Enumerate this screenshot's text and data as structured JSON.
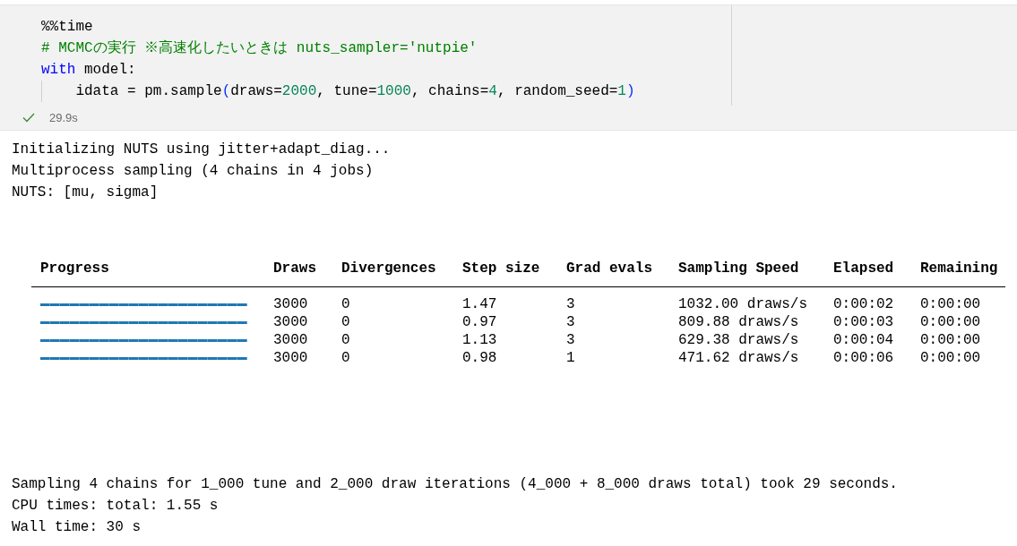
{
  "cell": {
    "code_lines": [
      {
        "indent_guide": false,
        "tokens": [
          {
            "kind": "plain",
            "text": "%%time"
          }
        ]
      },
      {
        "indent_guide": false,
        "tokens": [
          {
            "kind": "comment",
            "text": "# MCMCの実行 ※高速化したいときは nuts_sampler='nutpie'"
          }
        ]
      },
      {
        "indent_guide": false,
        "tokens": [
          {
            "kind": "keyword",
            "text": "with"
          },
          {
            "kind": "plain",
            "text": " model:"
          }
        ]
      },
      {
        "indent_guide": true,
        "tokens": [
          {
            "kind": "plain",
            "text": "    idata = pm.sample"
          },
          {
            "kind": "bracket",
            "text": "("
          },
          {
            "kind": "plain",
            "text": "draws="
          },
          {
            "kind": "number",
            "text": "2000"
          },
          {
            "kind": "plain",
            "text": ", tune="
          },
          {
            "kind": "number",
            "text": "1000"
          },
          {
            "kind": "plain",
            "text": ", chains="
          },
          {
            "kind": "number",
            "text": "4"
          },
          {
            "kind": "plain",
            "text": ", random_seed="
          },
          {
            "kind": "number",
            "text": "1"
          },
          {
            "kind": "bracket",
            "text": ")"
          }
        ]
      }
    ],
    "status": {
      "kind": "success",
      "duration": "29.9s"
    }
  },
  "output": {
    "log_lines": [
      "Initializing NUTS using jitter+adapt_diag...",
      "Multiprocess sampling (4 chains in 4 jobs)",
      "NUTS: [mu, sigma]"
    ],
    "progress_table": {
      "columns": [
        "Progress",
        "Draws",
        "Divergences",
        "Step size",
        "Grad evals",
        "Sampling Speed",
        "Elapsed",
        "Remaining"
      ],
      "rows": [
        {
          "cells": [
            {
              "kind": "progress",
              "level": 1
            },
            {
              "kind": "text",
              "text": "3000"
            },
            {
              "kind": "text",
              "text": "0"
            },
            {
              "kind": "text",
              "text": "1.47"
            },
            {
              "kind": "text",
              "text": "3"
            },
            {
              "kind": "text",
              "text": "1032.00 draws/s"
            },
            {
              "kind": "text",
              "text": "0:00:02"
            },
            {
              "kind": "text",
              "text": "0:00:00"
            }
          ]
        },
        {
          "cells": [
            {
              "kind": "progress",
              "level": 1
            },
            {
              "kind": "text",
              "text": "3000"
            },
            {
              "kind": "text",
              "text": "0"
            },
            {
              "kind": "text",
              "text": "0.97"
            },
            {
              "kind": "text",
              "text": "3"
            },
            {
              "kind": "text",
              "text": "809.88 draws/s"
            },
            {
              "kind": "text",
              "text": "0:00:03"
            },
            {
              "kind": "text",
              "text": "0:00:00"
            }
          ]
        },
        {
          "cells": [
            {
              "kind": "progress",
              "level": 1
            },
            {
              "kind": "text",
              "text": "3000"
            },
            {
              "kind": "text",
              "text": "0"
            },
            {
              "kind": "text",
              "text": "1.13"
            },
            {
              "kind": "text",
              "text": "3"
            },
            {
              "kind": "text",
              "text": "629.38 draws/s"
            },
            {
              "kind": "text",
              "text": "0:00:04"
            },
            {
              "kind": "text",
              "text": "0:00:00"
            }
          ]
        },
        {
          "cells": [
            {
              "kind": "progress",
              "level": 1
            },
            {
              "kind": "text",
              "text": "3000"
            },
            {
              "kind": "text",
              "text": "0"
            },
            {
              "kind": "text",
              "text": "0.98"
            },
            {
              "kind": "text",
              "text": "1"
            },
            {
              "kind": "text",
              "text": "471.62 draws/s"
            },
            {
              "kind": "text",
              "text": "0:00:06"
            },
            {
              "kind": "text",
              "text": "0:00:00"
            }
          ]
        }
      ]
    },
    "summary_lines": [
      "Sampling 4 chains for 1_000 tune and 2_000 draw iterations (4_000 + 8_000 draws total) took 29 seconds.",
      "CPU times: total: 1.55 s",
      "Wall time: 30 s"
    ]
  }
}
